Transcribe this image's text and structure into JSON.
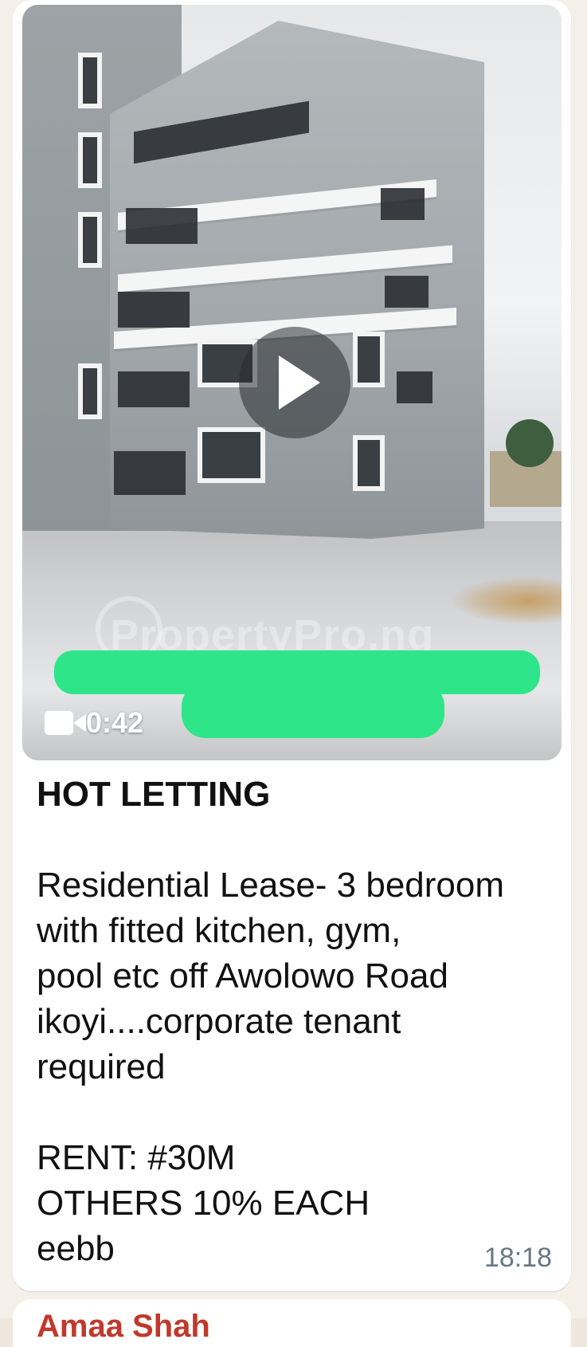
{
  "video": {
    "duration": "0:42",
    "watermark": "PropertyPro.ng",
    "play_icon": "play-icon",
    "camera_icon": "video-camera-icon"
  },
  "message": {
    "title": "HOT LETTING",
    "description_lines": [
      "Residential Lease- 3 bedroom",
      "with fitted kitchen, gym,",
      "pool etc off Awolowo Road",
      "ikoyi....corporate tenant",
      "required"
    ],
    "details_lines": [
      "RENT: #30M",
      "OTHERS 10% EACH",
      "eebb"
    ],
    "time": "18:18"
  },
  "next_message": {
    "sender": "Amaa Shah"
  },
  "colors": {
    "bubble": "#ffffff",
    "chat_bg": "#f4efe8",
    "timestamp": "#667781",
    "redaction_green": "#2fe58a"
  }
}
